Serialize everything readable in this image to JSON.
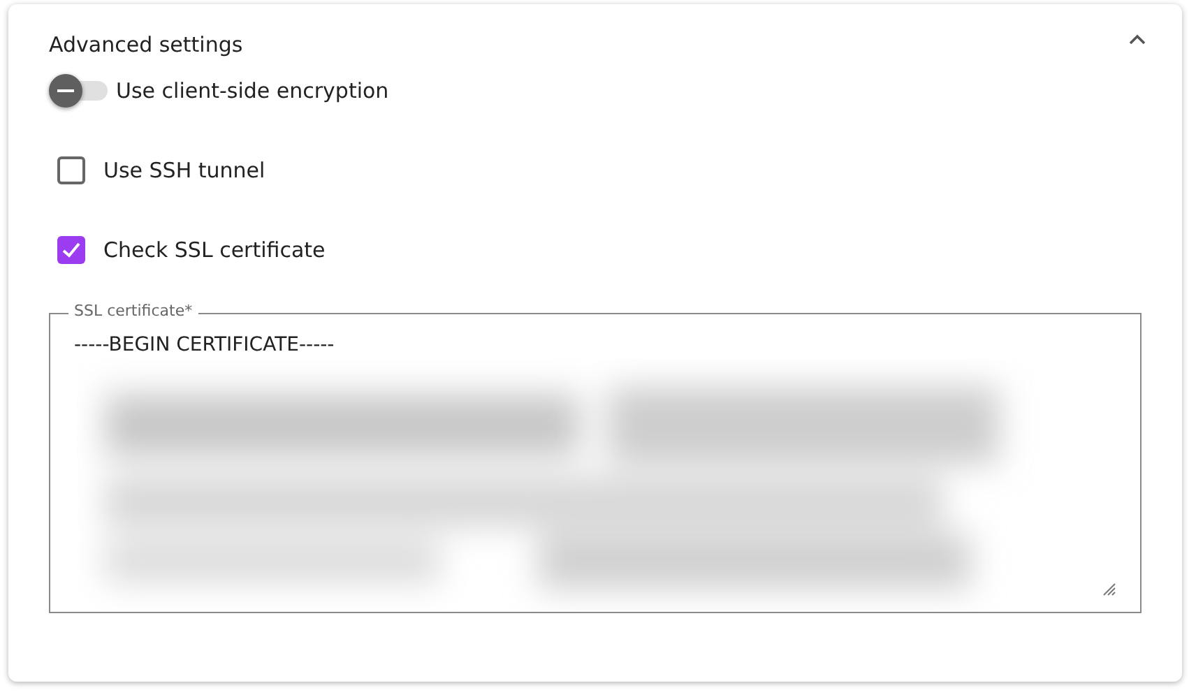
{
  "panel": {
    "title": "Advanced settings",
    "expanded": true
  },
  "options": [
    {
      "kind": "toggle",
      "label": "Use client-side encryption",
      "on": false
    },
    {
      "kind": "checkbox",
      "label": "Use SSH tunnel",
      "checked": false
    },
    {
      "kind": "checkbox",
      "label": "Check SSL certificate",
      "checked": true
    }
  ],
  "certificate_field": {
    "label": "SSL certificate*",
    "value": "-----BEGIN CERTIFICATE-----"
  }
}
